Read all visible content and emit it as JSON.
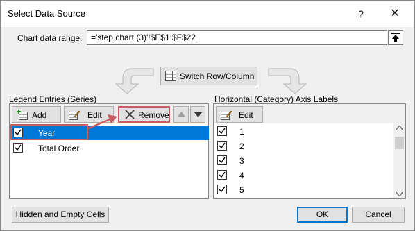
{
  "dialog": {
    "title": "Select Data Source",
    "help_glyph": "?",
    "close_glyph": "✕"
  },
  "range": {
    "label": "Chart data range:",
    "value": "='step chart (3)'!$E$1:$F$22"
  },
  "switch_button": {
    "label": "Switch Row/Column"
  },
  "legend": {
    "heading": "Legend Entries (Series)",
    "buttons": {
      "add": "Add",
      "edit": "Edit",
      "remove": "Remove"
    },
    "items": [
      {
        "label": "Year",
        "checked": true,
        "selected": true
      },
      {
        "label": "Total Order",
        "checked": true,
        "selected": false
      }
    ]
  },
  "axis": {
    "heading": "Horizontal (Category) Axis Labels",
    "edit_label": "Edit",
    "items": [
      {
        "label": "1",
        "checked": true
      },
      {
        "label": "2",
        "checked": true
      },
      {
        "label": "3",
        "checked": true
      },
      {
        "label": "4",
        "checked": true
      },
      {
        "label": "5",
        "checked": true
      }
    ]
  },
  "footer": {
    "hidden_cells": "Hidden and Empty Cells",
    "ok": "OK",
    "cancel": "Cancel"
  },
  "colors": {
    "selection": "#0078d7",
    "highlight": "#c75c63"
  }
}
